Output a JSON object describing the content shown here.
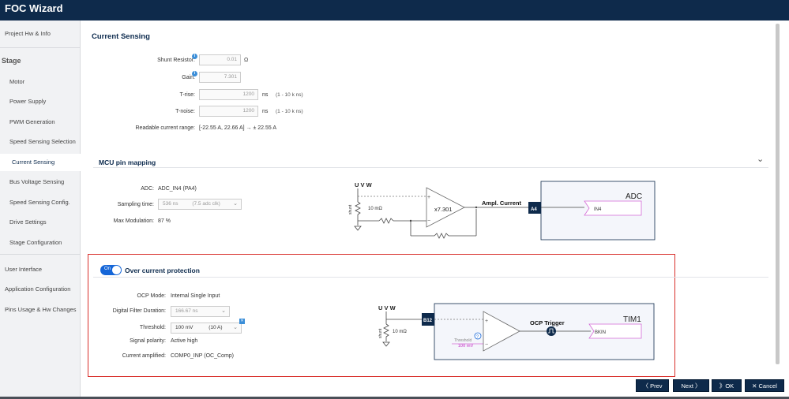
{
  "app": {
    "title": "FOC Wizard"
  },
  "sidebar": {
    "project": "Project Hw & Info",
    "stage_header": "Stage",
    "items": [
      "Motor",
      "Power Supply",
      "PWM Generation",
      "Speed Sensing Selection",
      "Current Sensing",
      "Bus Voltage Sensing",
      "Speed Sensing Config.",
      "Drive Settings",
      "Stage Configuration"
    ],
    "bottom_items": [
      "User Interface",
      "Application Configuration",
      "Pins Usage & Hw Changes"
    ]
  },
  "current_sensing": {
    "title": "Current Sensing",
    "shunt_label": "Shunt Resistor:",
    "shunt_value": "0.01",
    "shunt_unit": "Ω",
    "gain_label": "Gain:",
    "gain_value": "7.301",
    "trise_label": "T-rise:",
    "trise_value": "1200",
    "trise_unit": "ns",
    "trise_range": "(1 - 10 k ns)",
    "tnoise_label": "T-noise:",
    "tnoise_value": "1200",
    "tnoise_unit": "ns",
    "tnoise_range": "(1 - 10 k ns)",
    "range_label": "Readable current range:",
    "range_value": "[-22.55 A, 22.66 A] → ± 22.55 A",
    "info_symbol": "i"
  },
  "mcu_mapping": {
    "title": "MCU pin mapping",
    "chevron": "⌄",
    "adc_label": "ADC:",
    "adc_value": "ADC_IN4 (PA4)",
    "sampling_label": "Sampling time:",
    "sampling_value": "536 ns",
    "sampling_extra": "(7.5 adc clk)",
    "maxmod_label": "Max Modulation:",
    "maxmod_value": "87 %",
    "diagram": {
      "uvw": "U V W",
      "shunt": "shunt",
      "res": "10 mΩ",
      "plus": "+",
      "minus": "−",
      "gain": "x7.301",
      "ampl": "Ampl. Current",
      "pin": "A4",
      "block": "ADC",
      "input": "IN4"
    }
  },
  "ocp": {
    "toggle_label": "On",
    "title": "Over current protection",
    "mode_label": "OCP Mode:",
    "mode_value": "Internal Single Input",
    "filter_label": "Digital Filter Duration:",
    "filter_value": "166.67 ns",
    "threshold_label": "Threshold:",
    "threshold_value": "100 mV",
    "threshold_extra": "(10 A)",
    "polarity_label": "Signal polarity:",
    "polarity_value": "Active high",
    "amplified_label": "Current amplified:",
    "amplified_value": "COMP0_INP (OC_Comp)",
    "close_symbol": "✕",
    "diagram": {
      "uvw": "U V W",
      "shunt": "shunt",
      "res": "10 mΩ",
      "pin": "B12",
      "plus": "+",
      "minus": "−",
      "threshold_small": "Threshold",
      "threshold_val": "100 mV",
      "help": "?",
      "trigger": "OCP Trigger",
      "block": "TIM1",
      "input": "BKIN"
    }
  },
  "buttons": {
    "prev": "〈 Prev",
    "next": "Next 〉",
    "ok": "》OK",
    "cancel": "✕ Cancel"
  },
  "colors": {
    "navy": "#0e2a4b",
    "accent_blue": "#1566d8",
    "ocp_border": "#d9302c",
    "pin_magenta": "#d36ad6"
  }
}
